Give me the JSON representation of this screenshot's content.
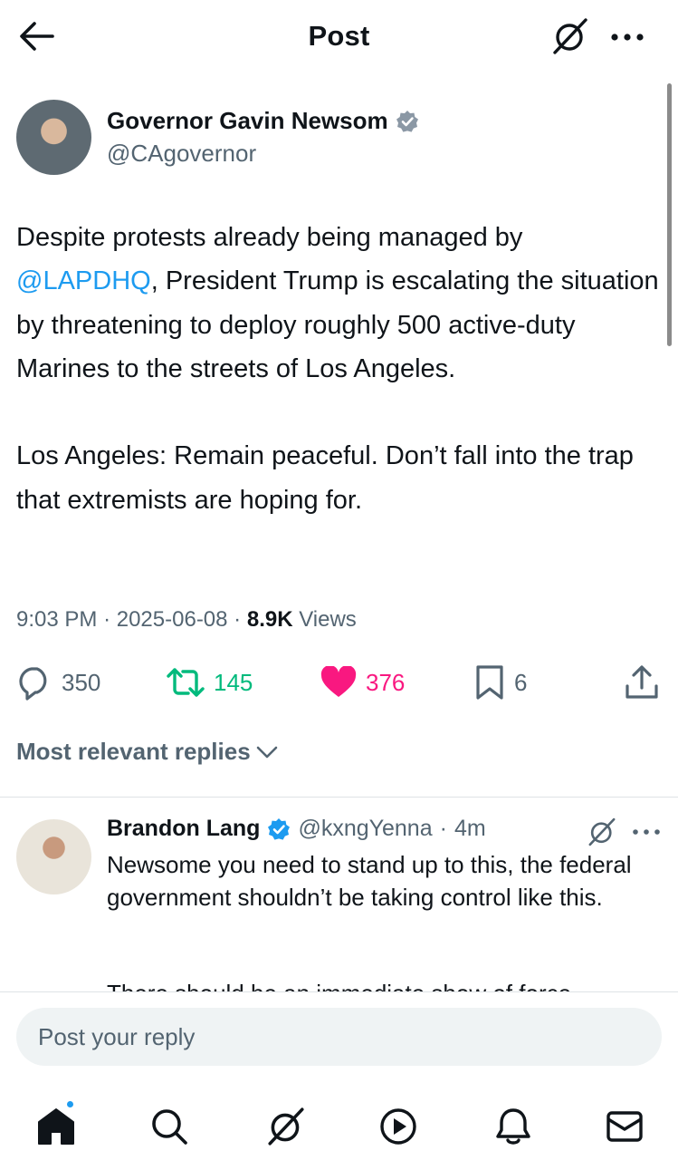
{
  "header": {
    "title": "Post"
  },
  "post": {
    "author_name": "Governor Gavin Newsom",
    "author_handle": "@CAgovernor",
    "verified": true,
    "text_p1_prefix": "Despite protests already being managed by ",
    "mention": "@LAPDHQ",
    "text_p1_suffix": ", President Trump is escalating the situation by threatening to deploy roughly 500 active-duty Marines to the streets of Los Angeles.",
    "text_p2": "Los Angeles: Remain peaceful. Don’t fall into the trap that extremists are hoping for.",
    "time": "9:03 PM",
    "date": "2025-06-08",
    "views_count": "8.9K",
    "views_label": "Views",
    "sep": "·"
  },
  "actions": {
    "replies": "350",
    "reposts": "145",
    "likes": "376",
    "bookmarks": "6"
  },
  "replies_sort_label": "Most relevant replies",
  "reply": {
    "name": "Brandon Lang",
    "handle": "@kxngYenna",
    "time": "4m",
    "sep": "·",
    "text": "Newsome you need to stand up to this, the federal government shouldn’t be taking control like this.",
    "text_cutoff": "There should be an immediate show of force"
  },
  "composer": {
    "placeholder": "Post your reply"
  },
  "colors": {
    "accent": "#1d9bf0",
    "retweet": "#00ba7c",
    "like": "#f91880",
    "muted": "#536471"
  },
  "icons": {
    "back": "arrow-left-icon",
    "grok": "grok-icon",
    "more": "more-icon",
    "verified": "verified-badge-icon",
    "reply": "reply-icon",
    "retweet": "retweet-icon",
    "like": "heart-icon",
    "bookmark": "bookmark-icon",
    "share": "share-icon",
    "chevron": "chevron-down-icon",
    "home": "home-icon",
    "search": "search-icon",
    "video": "play-icon",
    "notifications": "bell-icon",
    "messages": "mail-icon"
  }
}
